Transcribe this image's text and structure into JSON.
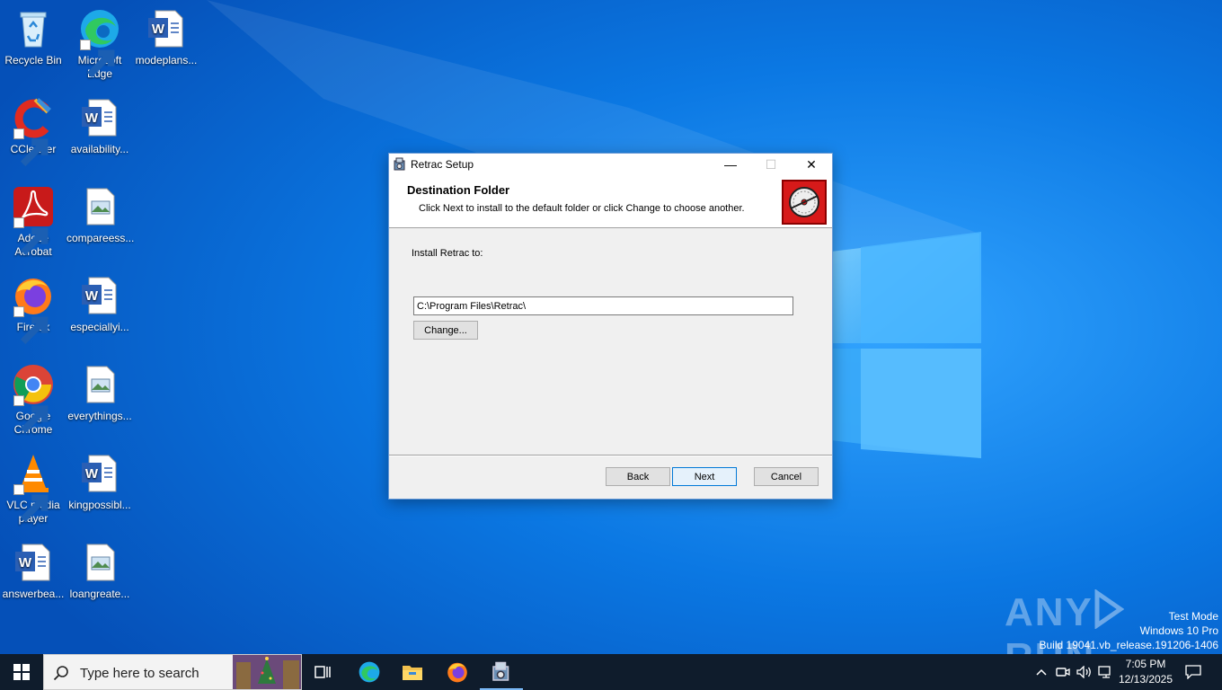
{
  "desktop": {
    "icons": [
      {
        "label": "Recycle Bin",
        "icon": "recycle-bin-icon"
      },
      {
        "label": "Microsoft Edge",
        "icon": "edge-icon"
      },
      {
        "label": "modeplans...",
        "icon": "word-doc-icon"
      },
      {
        "label": "CCleaner",
        "icon": "ccleaner-icon"
      },
      {
        "label": "availability...",
        "icon": "word-doc-icon"
      },
      {
        "label": "Adobe Acrobat",
        "icon": "acrobat-icon"
      },
      {
        "label": "compareess...",
        "icon": "image-file-icon"
      },
      {
        "label": "Firefox",
        "icon": "firefox-icon"
      },
      {
        "label": "especiallyi...",
        "icon": "word-doc-icon"
      },
      {
        "label": "Google Chrome",
        "icon": "chrome-icon"
      },
      {
        "label": "everythings...",
        "icon": "image-file-icon"
      },
      {
        "label": "VLC media player",
        "icon": "vlc-icon"
      },
      {
        "label": "kingpossibl...",
        "icon": "word-doc-icon"
      },
      {
        "label": "answerbea...",
        "icon": "word-doc-icon"
      },
      {
        "label": "loangreate...",
        "icon": "image-file-icon"
      }
    ]
  },
  "dialog": {
    "title": "Retrac Setup",
    "header_title": "Destination Folder",
    "header_description": "Click Next to install to the default folder or click Change to choose another.",
    "install_label": "Install Retrac to:",
    "install_path": "C:\\Program Files\\Retrac\\",
    "change_label": "Change...",
    "back_label": "Back",
    "next_label": "Next",
    "cancel_label": "Cancel",
    "minimize_glyph": "—",
    "maximize_glyph": "☐",
    "close_glyph": "✕"
  },
  "watermark": {
    "brand_left": "ANY",
    "brand_right": "RUN",
    "test_mode": "Test Mode",
    "os_edition": "Windows 10 Pro",
    "build": "Build 19041.vb_release.191206-1406"
  },
  "taskbar": {
    "search_placeholder": "Type here to search",
    "time": "7:05 PM",
    "date": "12/13/2025",
    "apps": [
      "task-view-icon",
      "edge-icon",
      "file-explorer-icon",
      "firefox-icon",
      "setup-installer-icon"
    ]
  },
  "colors": {
    "desktop_blue": "#0a6fd8",
    "taskbar": "#0f1c2c",
    "accent": "#0078d7",
    "logo_red": "#d71a1a"
  }
}
